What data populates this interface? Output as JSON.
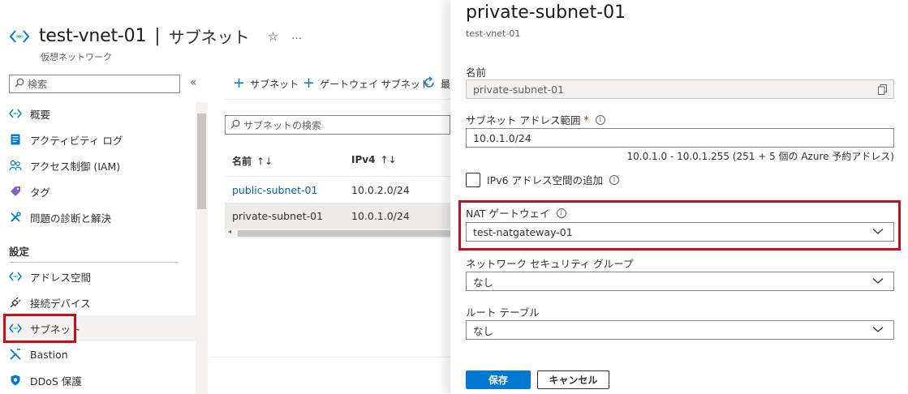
{
  "header": {
    "title": "test-vnet-01",
    "separator": "|",
    "page": "サブネット",
    "subtitle": "仮想ネットワーク",
    "more": "…",
    "icon": "vnet-icon",
    "star_icon": "star-icon"
  },
  "sidebar": {
    "search_placeholder": "検索",
    "collapse": "«",
    "items_top": [
      {
        "label": "概要",
        "icon": "vnet-icon"
      },
      {
        "label": "アクティビティ ログ",
        "icon": "log-icon"
      },
      {
        "label": "アクセス制御 (IAM)",
        "icon": "people-icon"
      },
      {
        "label": "タグ",
        "icon": "tag-icon"
      },
      {
        "label": "問題の診断と解決",
        "icon": "wrench-icon"
      }
    ],
    "section": "設定",
    "items_settings": [
      {
        "label": "アドレス空間",
        "icon": "vnet-icon"
      },
      {
        "label": "接続デバイス",
        "icon": "plug-icon"
      },
      {
        "label": "サブネット",
        "icon": "vnet-icon",
        "active": true
      },
      {
        "label": "Bastion",
        "icon": "bastion-icon"
      },
      {
        "label": "DDoS 保護",
        "icon": "shield-icon"
      }
    ]
  },
  "content": {
    "commands": {
      "add_subnet": "サブネット",
      "add_gateway_subnet": "ゲートウェイ サブネット",
      "refresh_partial": "最"
    },
    "filter_placeholder": "サブネットの検索",
    "columns": {
      "name": "名前",
      "ipv4": "IPv4",
      "sort": "↑↓"
    },
    "rows": [
      {
        "name": "public-subnet-01",
        "ipv4": "10.0.2.0/24"
      },
      {
        "name": "private-subnet-01",
        "ipv4": "10.0.1.0/24"
      }
    ]
  },
  "panel": {
    "title": "private-subnet-01",
    "subtitle": "test-vnet-01",
    "name_label": "名前",
    "name_value": "private-subnet-01",
    "range_label": "サブネット アドレス範囲",
    "required_mark": "*",
    "range_value": "10.0.1.0/24",
    "range_hint": "10.0.1.0 - 10.0.1.255 (251 + 5 個の Azure 予約アドレス)",
    "ipv6_label": "IPv6 アドレス空間の追加",
    "ipv6_checked": false,
    "nat_label": "NAT ゲートウェイ",
    "nat_value": "test-natgateway-01",
    "nsg_label": "ネットワーク セキュリティ グループ",
    "nsg_value": "なし",
    "route_label": "ルート テーブル",
    "route_value": "なし",
    "save": "保存",
    "cancel": "キャンセル",
    "info_glyph": "i"
  },
  "colors": {
    "accent": "#0078d4",
    "highlight": "#c50f1f",
    "link": "#0062ad"
  }
}
